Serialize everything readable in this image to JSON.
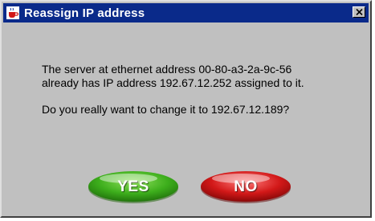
{
  "window": {
    "title": "Reassign IP address",
    "close_glyph": "✕",
    "icon": "java-coffee-cup-icon"
  },
  "message": {
    "line1": "The server at ethernet address 00-80-a3-2a-9c-56",
    "line2": "already has IP address 192.67.12.252 assigned to it.",
    "line3": "Do you really want to change it to 192.67.12.189?"
  },
  "buttons": {
    "yes_label": "YES",
    "no_label": "NO",
    "yes_color": "#3dae1c",
    "no_color": "#d21818"
  },
  "colors": {
    "titlebar": "#0a2a8a",
    "dialog_bg": "#c0c0c0"
  }
}
